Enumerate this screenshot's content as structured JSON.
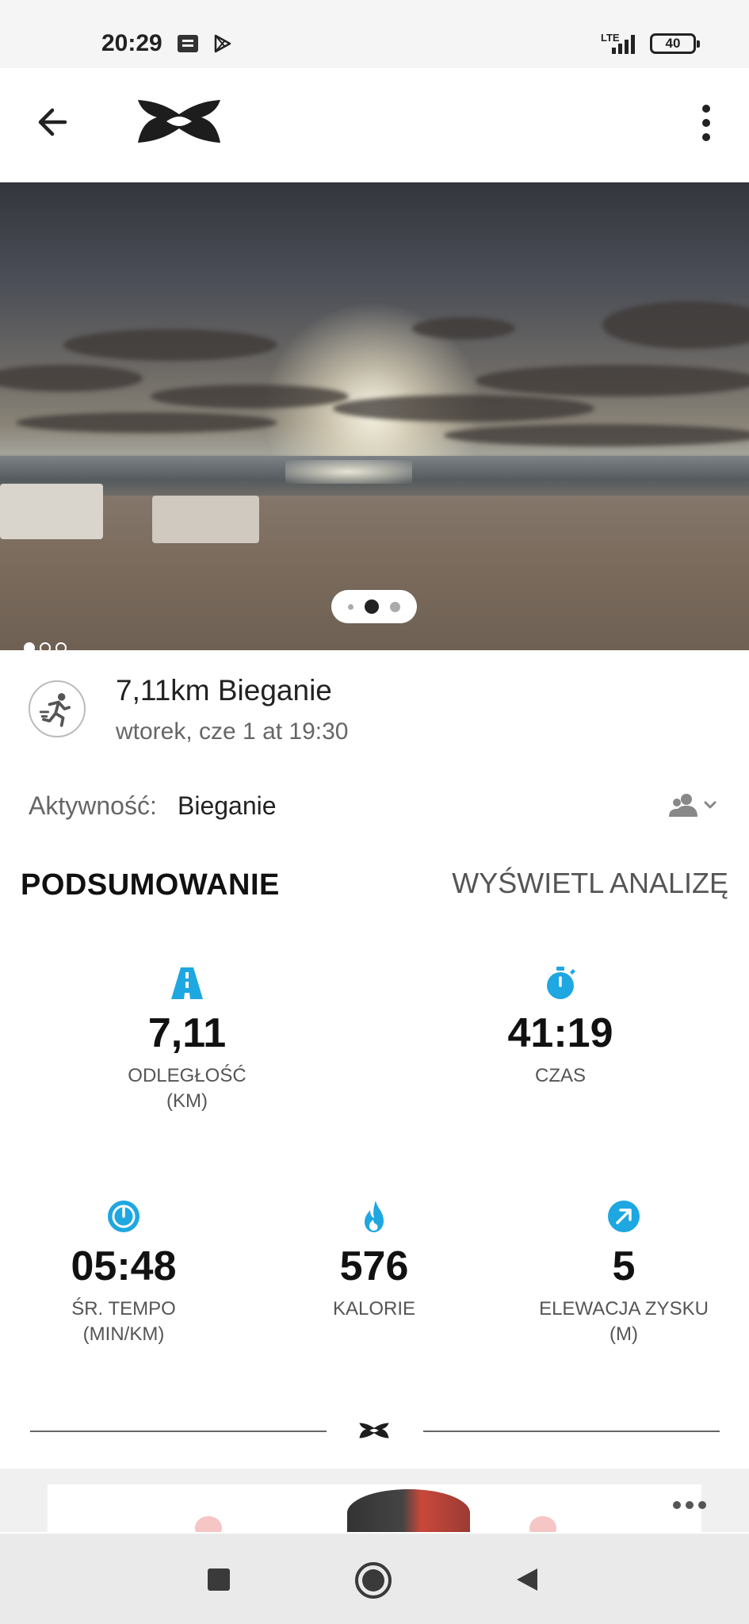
{
  "status_bar": {
    "time": "20:29",
    "network": "LTE",
    "battery": "40",
    "icons": [
      "gmail-icon",
      "play-store-icon",
      "signal-icon",
      "battery-icon"
    ]
  },
  "app_bar": {
    "back_icon": "arrow-left-icon",
    "logo": "under-armour-logo",
    "menu_icon": "more-vertical-icon"
  },
  "hero": {
    "photo": "beach sunset photo",
    "pager_count": 3,
    "pager_active": 2
  },
  "activity": {
    "title": "7,11km Bieganie",
    "date": "wtorek, cze 1 at 19:30",
    "type_label": "Aktywność:",
    "type_value": "Bieganie"
  },
  "summary": {
    "title": "PODSUMOWANIE",
    "analysis_link": "WYŚWIETL ANALIZĘ",
    "stats": [
      {
        "id": "distance",
        "value": "7,11",
        "label": "ODLEGŁOŚĆ\n(KM)",
        "icon": "road-icon"
      },
      {
        "id": "time",
        "value": "41:19",
        "label": "CZAS",
        "icon": "stopwatch-icon"
      },
      {
        "id": "pace",
        "value": "05:48",
        "label": "ŚR. TEMPO\n(MIN/KM)",
        "icon": "speedometer-icon"
      },
      {
        "id": "calories",
        "value": "576",
        "label": "KALORIE",
        "icon": "flame-icon"
      },
      {
        "id": "elevation",
        "value": "5",
        "label": "ELEWACJA ZYSKU\n(M)",
        "icon": "arrow-up-right-icon"
      }
    ]
  },
  "colors": {
    "accent": "#1ea7e1",
    "text": "#222222",
    "muted": "#666666"
  },
  "nav_bar": {
    "icons": [
      "recent-apps-icon",
      "home-icon",
      "back-icon"
    ]
  }
}
